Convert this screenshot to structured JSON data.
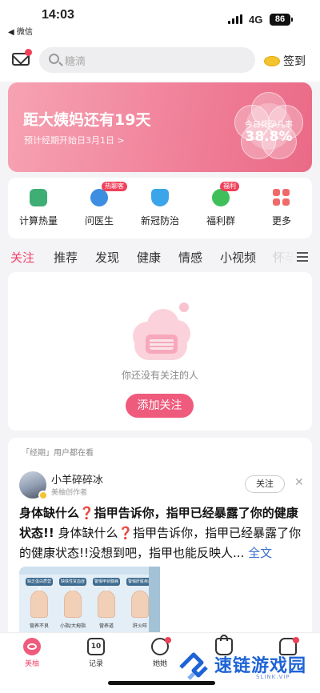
{
  "status_bar": {
    "time": "14:03",
    "back_label": "◀ 微信",
    "network": "4G",
    "battery": "86"
  },
  "top_bar": {
    "search_placeholder": "糖滴",
    "signin_label": "签到"
  },
  "banner": {
    "title": "距大姨妈还有19天",
    "subtitle": "预计经期开始日3月1日 >",
    "pregnancy_label": "今日怀孕几率",
    "pregnancy_value": "38.8%"
  },
  "quick_actions": [
    {
      "label": "计算热量",
      "icon": "calculator-icon",
      "color": "#3fae74"
    },
    {
      "label": "问医生",
      "icon": "doctor-icon",
      "color": "#3d8de0",
      "badge": "热聊客"
    },
    {
      "label": "新冠防治",
      "icon": "shield-icon",
      "color": "#3aa5e8"
    },
    {
      "label": "福利群",
      "icon": "chat-group-icon",
      "color": "#3fbf5a",
      "badge": "福利"
    },
    {
      "label": "更多",
      "icon": "grid-icon",
      "color": "#f06a6a"
    }
  ],
  "tabs": [
    "关注",
    "推荐",
    "发现",
    "健康",
    "情感",
    "小视频",
    "怀孕"
  ],
  "active_tab": 0,
  "follow_empty": {
    "message": "你还没有关注的人",
    "button": "添加关注"
  },
  "post": {
    "hint": "「经期」用户都在看",
    "author": "小羊碎碎冰",
    "author_role": "美柚创作者",
    "follow_label": "关注",
    "close_label": "✕",
    "title_a": "身体缺什么",
    "title_b": "指甲告诉你，指甲已经暴露了你的健康状态!!",
    "body_a": "身体缺什么",
    "body_b": "指甲告诉你，指甲已经暴露了你的健康状态!!没想到吧，指甲也能反映人...",
    "question_mark": "❓",
    "more_label": "全文",
    "image_columns": [
      {
        "tag": "缺乏蛋白质营养",
        "name": "营养不良"
      },
      {
        "tag": "缺铁性贫血症状",
        "name": "小指/大拇指"
      },
      {
        "tag": "警惕甲状腺病变",
        "name": "营养道"
      },
      {
        "tag": "警惕肝脏疾病",
        "name": "肝火旺"
      }
    ]
  },
  "bottom_nav": [
    {
      "label": "美柚",
      "icon": "meiyou-icon",
      "active": true
    },
    {
      "label": "记录",
      "icon": "calendar-icon",
      "active": false
    },
    {
      "label": "她她",
      "icon": "search-heart-icon",
      "active": false,
      "dot": true
    },
    {
      "label": "",
      "icon": "shop-bag-icon",
      "active": false
    },
    {
      "label": "",
      "icon": "profile-icon",
      "active": false,
      "dot": true
    }
  ],
  "watermark": {
    "text": "速链游戏园",
    "sub": "SLINK.VIP"
  }
}
